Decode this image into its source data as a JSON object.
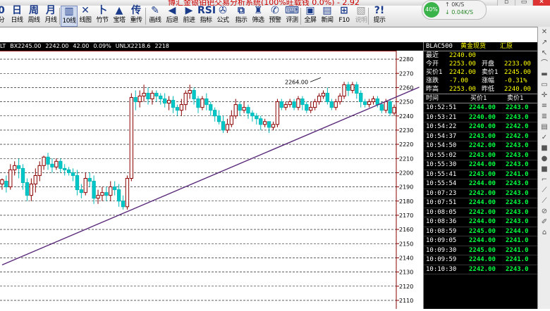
{
  "window": {
    "title": "博汇金银铂钯交易分析系统(100%旺载钱 0.0%) - 2.92",
    "controls": [
      "▫",
      "▭",
      "✕"
    ]
  },
  "network": {
    "percent": "40%",
    "upload": "0K/S",
    "download": "0.04K/S"
  },
  "toolbar": [
    {
      "id": "fenshi",
      "icon": "0",
      "label": "分",
      "x": -10
    },
    {
      "id": "day",
      "icon": "日",
      "label": "日线",
      "x": 12
    },
    {
      "id": "week",
      "icon": "周",
      "label": "周线",
      "x": 36
    },
    {
      "id": "month",
      "icon": "月",
      "label": "月线",
      "x": 60
    },
    {
      "id": "tick10",
      "icon": "▥",
      "label": "10线",
      "x": 86,
      "active": true
    },
    {
      "id": "lineplot",
      "icon": "✕",
      "label": "线图",
      "x": 109
    },
    {
      "id": "bamboo",
      "icon": "卜",
      "label": "竹节",
      "x": 133
    },
    {
      "id": "tower",
      "icon": "▲",
      "label": "宝塔",
      "x": 157
    },
    {
      "id": "reset",
      "icon": "传",
      "label": "重传",
      "x": 181
    },
    {
      "id": "draw",
      "icon": "✎",
      "label": "画线",
      "x": 208
    },
    {
      "id": "back",
      "icon": "◀",
      "label": "后退",
      "x": 232
    },
    {
      "id": "forward",
      "icon": "▶",
      "label": "前进",
      "x": 256
    },
    {
      "id": "indicator",
      "icon": "RSI",
      "label": "指标",
      "x": 280
    },
    {
      "id": "formula",
      "icon": "✇",
      "label": "公式",
      "x": 304
    },
    {
      "id": "index",
      "icon": "⧉",
      "label": "指示",
      "x": 330
    },
    {
      "id": "filter",
      "icon": "♜",
      "label": "筛选",
      "x": 354
    },
    {
      "id": "alert",
      "icon": "✆",
      "label": "预警",
      "x": 378
    },
    {
      "id": "review",
      "icon": "⌨",
      "label": "评测",
      "x": 402
    },
    {
      "id": "fullscreen",
      "icon": "▣",
      "label": "全屏",
      "x": 428
    },
    {
      "id": "news",
      "icon": "▤",
      "label": "新闻",
      "x": 452
    },
    {
      "id": "f10",
      "icon": "⊞",
      "label": "F10",
      "x": 476
    },
    {
      "id": "notes",
      "icon": "▧",
      "label": "说明",
      "x": 500,
      "disabled": true
    },
    {
      "id": "tips",
      "icon": "?!",
      "label": "提示",
      "x": 526
    }
  ],
  "separators": [
    84,
    206,
    426,
    522
  ],
  "chart_info": [
    "LT",
    "BX2245.00",
    "2242.00",
    "42.00",
    "0.09%",
    "UNLX2218.6",
    "2218"
  ],
  "quote_panel": {
    "header": {
      "code": "BLAC500",
      "name": "黄金现货",
      "exchange": "汇原"
    },
    "latest": {
      "label": "最近",
      "value": "2240.00"
    },
    "stats": [
      {
        "k1": "今开",
        "v1": "2253.00",
        "k2": "开盘",
        "v2": "2233.00"
      },
      {
        "k1": "买价1",
        "v1": "2242.00",
        "k2": "卖价1",
        "v2": "2245.00"
      },
      {
        "k1": "涨跌",
        "v1": "-7.00",
        "k2": "涨幅",
        "v2": "-0.31%"
      },
      {
        "k1": "昨高",
        "v1": "2253.00",
        "k2": "昨低",
        "v2": "2240.00"
      }
    ],
    "tick_header": [
      "时间",
      "买价1",
      "卖价1"
    ],
    "ticks": [
      [
        "10:52:51",
        "2244.00",
        "2243.0"
      ],
      [
        "10:53:21",
        "2240.00",
        "2243.0"
      ],
      [
        "10:54:22",
        "2240.00",
        "2242.0"
      ],
      [
        "10:54:37",
        "2243.00",
        "2242.0"
      ],
      [
        "10:54:50",
        "2242.00",
        "2243.0"
      ],
      [
        "10:55:02",
        "2243.00",
        "2243.0"
      ],
      [
        "10:55:30",
        "2244.00",
        "2243.0"
      ],
      [
        "10:55:41",
        "2243.00",
        "2241.0"
      ],
      [
        "10:55:54",
        "2244.00",
        "2243.0"
      ],
      [
        "10:07:23",
        "2242.00",
        "2243.0"
      ],
      [
        "10:07:51",
        "2244.00",
        "2243.0"
      ],
      [
        "10:08:05",
        "2242.00",
        "2243.0"
      ],
      [
        "10:08:36",
        "2244.00",
        "2243.0"
      ],
      [
        "10:08:59",
        "2245.00",
        "2244.0"
      ],
      [
        "10:09:05",
        "2244.00",
        "2241.0"
      ],
      [
        "10:09:30",
        "2245.00",
        "2241.0"
      ],
      [
        "10:09:59",
        "2244.00",
        "2241.0"
      ],
      [
        "10:10:30",
        "2242.00",
        "2243.0"
      ]
    ]
  },
  "chart_data": {
    "type": "candlestick",
    "ylim": [
      2105,
      2285
    ],
    "yticks": [
      2280,
      2270,
      2260,
      2250,
      2240,
      2230,
      2220,
      2210,
      2200,
      2190,
      2180,
      2170,
      2160,
      2150,
      2140,
      2130,
      2120,
      2110
    ],
    "annotation": {
      "text": "2264.00",
      "value": 2264
    },
    "trendline": [
      [
        0,
        2135
      ],
      [
        95,
        2254
      ]
    ],
    "candles": [
      [
        2192,
        2195,
        2188,
        2196
      ],
      [
        2194,
        2190,
        2186,
        2198
      ],
      [
        2190,
        2202,
        2188,
        2206
      ],
      [
        2202,
        2205,
        2198,
        2208
      ],
      [
        2205,
        2203,
        2196,
        2210
      ],
      [
        2203,
        2193,
        2188,
        2206
      ],
      [
        2193,
        2184,
        2180,
        2196
      ],
      [
        2184,
        2192,
        2180,
        2196
      ],
      [
        2192,
        2198,
        2186,
        2203
      ],
      [
        2198,
        2205,
        2194,
        2208
      ],
      [
        2205,
        2211,
        2202,
        2212
      ],
      [
        2211,
        2206,
        2202,
        2214
      ],
      [
        2206,
        2204,
        2200,
        2210
      ],
      [
        2204,
        2208,
        2202,
        2210
      ],
      [
        2208,
        2203,
        2200,
        2210
      ],
      [
        2203,
        2202,
        2198,
        2206
      ],
      [
        2202,
        2200,
        2198,
        2204
      ],
      [
        2200,
        2198,
        2194,
        2203
      ],
      [
        2198,
        2188,
        2184,
        2202
      ],
      [
        2188,
        2186,
        2182,
        2192
      ],
      [
        2186,
        2196,
        2184,
        2200
      ],
      [
        2196,
        2194,
        2190,
        2200
      ],
      [
        2194,
        2182,
        2178,
        2198
      ],
      [
        2182,
        2184,
        2178,
        2188
      ],
      [
        2184,
        2186,
        2180,
        2190
      ],
      [
        2186,
        2184,
        2180,
        2190
      ],
      [
        2184,
        2190,
        2180,
        2194
      ],
      [
        2190,
        2188,
        2184,
        2194
      ],
      [
        2188,
        2180,
        2176,
        2192
      ],
      [
        2180,
        2176,
        2174,
        2184
      ],
      [
        2176,
        2196,
        2174,
        2198
      ],
      [
        2196,
        2253,
        2194,
        2256
      ],
      [
        2253,
        2250,
        2244,
        2258
      ],
      [
        2250,
        2254,
        2246,
        2258
      ],
      [
        2254,
        2256,
        2250,
        2262
      ],
      [
        2256,
        2252,
        2248,
        2260
      ],
      [
        2252,
        2256,
        2248,
        2258
      ],
      [
        2256,
        2254,
        2250,
        2258
      ],
      [
        2254,
        2252,
        2248,
        2256
      ],
      [
        2252,
        2249,
        2246,
        2256
      ],
      [
        2249,
        2251,
        2244,
        2254
      ],
      [
        2251,
        2246,
        2242,
        2254
      ],
      [
        2246,
        2244,
        2240,
        2248
      ],
      [
        2244,
        2248,
        2240,
        2252
      ],
      [
        2248,
        2256,
        2244,
        2258
      ],
      [
        2256,
        2258,
        2252,
        2262
      ],
      [
        2258,
        2252,
        2248,
        2260
      ],
      [
        2252,
        2246,
        2242,
        2254
      ],
      [
        2246,
        2252,
        2244,
        2254
      ],
      [
        2252,
        2248,
        2244,
        2256
      ],
      [
        2248,
        2244,
        2240,
        2250
      ],
      [
        2244,
        2240,
        2236,
        2246
      ],
      [
        2240,
        2236,
        2234,
        2244
      ],
      [
        2236,
        2230,
        2228,
        2240
      ],
      [
        2230,
        2234,
        2228,
        2238
      ],
      [
        2234,
        2240,
        2232,
        2244
      ],
      [
        2240,
        2248,
        2238,
        2252
      ],
      [
        2248,
        2244,
        2240,
        2250
      ],
      [
        2244,
        2246,
        2242,
        2250
      ],
      [
        2246,
        2242,
        2238,
        2248
      ],
      [
        2242,
        2240,
        2236,
        2244
      ],
      [
        2240,
        2238,
        2234,
        2242
      ],
      [
        2238,
        2234,
        2230,
        2240
      ],
      [
        2234,
        2236,
        2232,
        2238
      ],
      [
        2236,
        2232,
        2228,
        2236
      ],
      [
        2232,
        2234,
        2230,
        2236
      ],
      [
        2234,
        2250,
        2232,
        2252
      ],
      [
        2250,
        2246,
        2244,
        2252
      ],
      [
        2246,
        2248,
        2244,
        2250
      ],
      [
        2248,
        2250,
        2246,
        2252
      ],
      [
        2250,
        2246,
        2244,
        2252
      ],
      [
        2246,
        2252,
        2244,
        2254
      ],
      [
        2252,
        2248,
        2244,
        2254
      ],
      [
        2248,
        2244,
        2242,
        2250
      ],
      [
        2244,
        2246,
        2242,
        2250
      ],
      [
        2246,
        2250,
        2244,
        2252
      ],
      [
        2250,
        2254,
        2248,
        2256
      ],
      [
        2254,
        2256,
        2252,
        2258
      ],
      [
        2256,
        2250,
        2248,
        2260
      ],
      [
        2250,
        2246,
        2244,
        2252
      ],
      [
        2246,
        2250,
        2244,
        2252
      ],
      [
        2250,
        2254,
        2248,
        2256
      ],
      [
        2254,
        2262,
        2252,
        2264
      ],
      [
        2262,
        2258,
        2254,
        2264
      ],
      [
        2258,
        2262,
        2256,
        2264
      ],
      [
        2262,
        2256,
        2252,
        2264
      ],
      [
        2256,
        2250,
        2246,
        2258
      ],
      [
        2250,
        2248,
        2246,
        2252
      ],
      [
        2248,
        2250,
        2246,
        2252
      ],
      [
        2250,
        2252,
        2248,
        2254
      ],
      [
        2252,
        2248,
        2246,
        2254
      ],
      [
        2248,
        2244,
        2242,
        2250
      ],
      [
        2244,
        2250,
        2242,
        2252
      ],
      [
        2250,
        2242,
        2240,
        2252
      ],
      [
        2242,
        2246,
        2240,
        2248
      ]
    ]
  },
  "sidebar_icons": [
    "✕",
    "↗",
    "↖",
    "⌒",
    "▬",
    "▭",
    "✛",
    "≡",
    "≣",
    "▤",
    "✓",
    "■",
    "●",
    "■",
    "⌐",
    "⟋",
    "⟋",
    "⊘",
    "✐",
    "⌂"
  ]
}
